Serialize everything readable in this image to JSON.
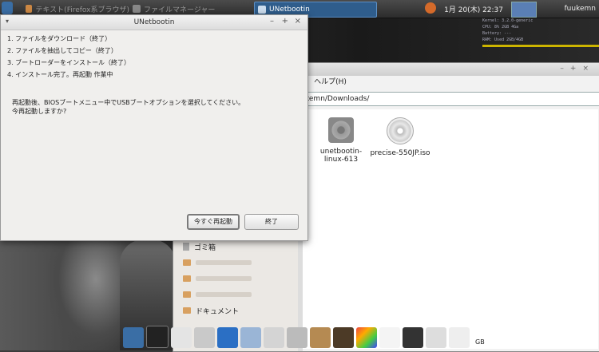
{
  "top_panel": {
    "tasks": [
      {
        "label": "テキスト(Firefox系ブラウザ)",
        "state": "dim"
      },
      {
        "label": "ファイルマネージャー",
        "state": "dim"
      },
      {
        "label": "UNetbootin",
        "state": "active"
      }
    ],
    "clock": "1月 20(木) 22:37",
    "user": "fuukemn"
  },
  "conky": {
    "lines": [
      "Kernel: 3.2.0-generic",
      "CPU: 8% 2GB 4Ga",
      "Battery: ---",
      "RAM: Used 2GB/4GB"
    ]
  },
  "file_manager": {
    "menu_help": "ヘルプ(H)",
    "menu_prefix": "S)",
    "address": "kemn/Downloads/",
    "files": [
      {
        "name": "unetbootin-linux-613",
        "icon": "gear-icon"
      },
      {
        "name": "precise-550JP.iso",
        "icon": "disc-icon"
      }
    ],
    "sidebar": [
      {
        "label": "ゴミ箱",
        "icon": "trash-icon"
      },
      {
        "label": "",
        "icon": "folder-icon"
      },
      {
        "label": "",
        "icon": "folder-icon"
      },
      {
        "label": "",
        "icon": "folder-icon"
      },
      {
        "label": "ドキュメント",
        "icon": "folder-icon"
      }
    ]
  },
  "dialog": {
    "title": "UNetbootin",
    "steps": [
      "1. ファイルをダウンロード（終了）",
      "2. ファイルを抽出してコピー（終了）",
      "3. ブートローダーをインストール（終了）",
      "4. インストール完了。再起動 作業中"
    ],
    "message_line1": "再起動後、BIOSブートメニュー中でUSBブートオプションを選択してください。",
    "message_line2": "今再起動しますか?",
    "reboot_button": "今すぐ再起動",
    "exit_button": "終了"
  },
  "dock": {
    "items": [
      "monitor-icon",
      "terminal-icon",
      "files-icon",
      "text-editor-icon",
      "browser-icon",
      "settings-icon",
      "image-icon",
      "search-icon",
      "archive-icon",
      "speaker-icon",
      "paint-icon",
      "font-icon",
      "disc-icon",
      "trash-icon",
      "refresh-icon"
    ],
    "status": "GB"
  }
}
